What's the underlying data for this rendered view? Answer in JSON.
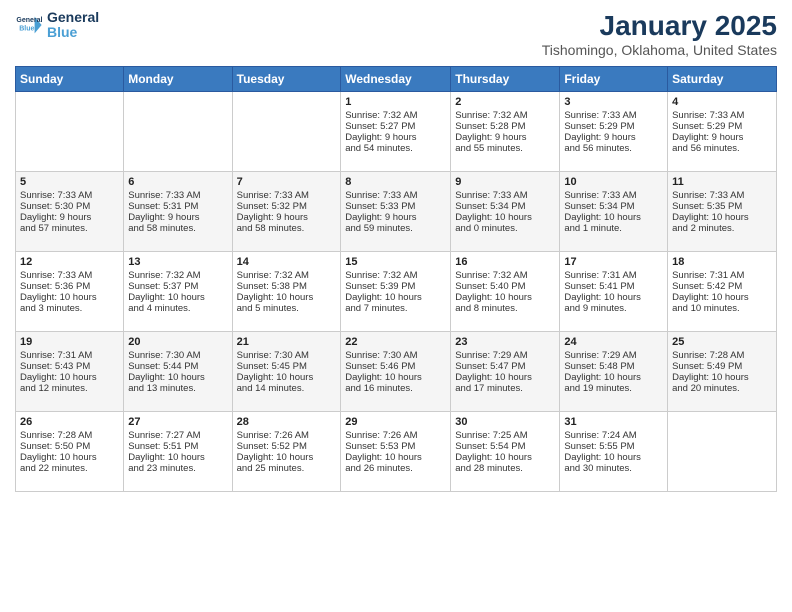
{
  "header": {
    "logo_line1": "General",
    "logo_line2": "Blue",
    "month": "January 2025",
    "location": "Tishomingo, Oklahoma, United States"
  },
  "weekdays": [
    "Sunday",
    "Monday",
    "Tuesday",
    "Wednesday",
    "Thursday",
    "Friday",
    "Saturday"
  ],
  "weeks": [
    [
      {
        "day": "",
        "info": ""
      },
      {
        "day": "",
        "info": ""
      },
      {
        "day": "",
        "info": ""
      },
      {
        "day": "1",
        "info": "Sunrise: 7:32 AM\nSunset: 5:27 PM\nDaylight: 9 hours\nand 54 minutes."
      },
      {
        "day": "2",
        "info": "Sunrise: 7:32 AM\nSunset: 5:28 PM\nDaylight: 9 hours\nand 55 minutes."
      },
      {
        "day": "3",
        "info": "Sunrise: 7:33 AM\nSunset: 5:29 PM\nDaylight: 9 hours\nand 56 minutes."
      },
      {
        "day": "4",
        "info": "Sunrise: 7:33 AM\nSunset: 5:29 PM\nDaylight: 9 hours\nand 56 minutes."
      }
    ],
    [
      {
        "day": "5",
        "info": "Sunrise: 7:33 AM\nSunset: 5:30 PM\nDaylight: 9 hours\nand 57 minutes."
      },
      {
        "day": "6",
        "info": "Sunrise: 7:33 AM\nSunset: 5:31 PM\nDaylight: 9 hours\nand 58 minutes."
      },
      {
        "day": "7",
        "info": "Sunrise: 7:33 AM\nSunset: 5:32 PM\nDaylight: 9 hours\nand 58 minutes."
      },
      {
        "day": "8",
        "info": "Sunrise: 7:33 AM\nSunset: 5:33 PM\nDaylight: 9 hours\nand 59 minutes."
      },
      {
        "day": "9",
        "info": "Sunrise: 7:33 AM\nSunset: 5:34 PM\nDaylight: 10 hours\nand 0 minutes."
      },
      {
        "day": "10",
        "info": "Sunrise: 7:33 AM\nSunset: 5:34 PM\nDaylight: 10 hours\nand 1 minute."
      },
      {
        "day": "11",
        "info": "Sunrise: 7:33 AM\nSunset: 5:35 PM\nDaylight: 10 hours\nand 2 minutes."
      }
    ],
    [
      {
        "day": "12",
        "info": "Sunrise: 7:33 AM\nSunset: 5:36 PM\nDaylight: 10 hours\nand 3 minutes."
      },
      {
        "day": "13",
        "info": "Sunrise: 7:32 AM\nSunset: 5:37 PM\nDaylight: 10 hours\nand 4 minutes."
      },
      {
        "day": "14",
        "info": "Sunrise: 7:32 AM\nSunset: 5:38 PM\nDaylight: 10 hours\nand 5 minutes."
      },
      {
        "day": "15",
        "info": "Sunrise: 7:32 AM\nSunset: 5:39 PM\nDaylight: 10 hours\nand 7 minutes."
      },
      {
        "day": "16",
        "info": "Sunrise: 7:32 AM\nSunset: 5:40 PM\nDaylight: 10 hours\nand 8 minutes."
      },
      {
        "day": "17",
        "info": "Sunrise: 7:31 AM\nSunset: 5:41 PM\nDaylight: 10 hours\nand 9 minutes."
      },
      {
        "day": "18",
        "info": "Sunrise: 7:31 AM\nSunset: 5:42 PM\nDaylight: 10 hours\nand 10 minutes."
      }
    ],
    [
      {
        "day": "19",
        "info": "Sunrise: 7:31 AM\nSunset: 5:43 PM\nDaylight: 10 hours\nand 12 minutes."
      },
      {
        "day": "20",
        "info": "Sunrise: 7:30 AM\nSunset: 5:44 PM\nDaylight: 10 hours\nand 13 minutes."
      },
      {
        "day": "21",
        "info": "Sunrise: 7:30 AM\nSunset: 5:45 PM\nDaylight: 10 hours\nand 14 minutes."
      },
      {
        "day": "22",
        "info": "Sunrise: 7:30 AM\nSunset: 5:46 PM\nDaylight: 10 hours\nand 16 minutes."
      },
      {
        "day": "23",
        "info": "Sunrise: 7:29 AM\nSunset: 5:47 PM\nDaylight: 10 hours\nand 17 minutes."
      },
      {
        "day": "24",
        "info": "Sunrise: 7:29 AM\nSunset: 5:48 PM\nDaylight: 10 hours\nand 19 minutes."
      },
      {
        "day": "25",
        "info": "Sunrise: 7:28 AM\nSunset: 5:49 PM\nDaylight: 10 hours\nand 20 minutes."
      }
    ],
    [
      {
        "day": "26",
        "info": "Sunrise: 7:28 AM\nSunset: 5:50 PM\nDaylight: 10 hours\nand 22 minutes."
      },
      {
        "day": "27",
        "info": "Sunrise: 7:27 AM\nSunset: 5:51 PM\nDaylight: 10 hours\nand 23 minutes."
      },
      {
        "day": "28",
        "info": "Sunrise: 7:26 AM\nSunset: 5:52 PM\nDaylight: 10 hours\nand 25 minutes."
      },
      {
        "day": "29",
        "info": "Sunrise: 7:26 AM\nSunset: 5:53 PM\nDaylight: 10 hours\nand 26 minutes."
      },
      {
        "day": "30",
        "info": "Sunrise: 7:25 AM\nSunset: 5:54 PM\nDaylight: 10 hours\nand 28 minutes."
      },
      {
        "day": "31",
        "info": "Sunrise: 7:24 AM\nSunset: 5:55 PM\nDaylight: 10 hours\nand 30 minutes."
      },
      {
        "day": "",
        "info": ""
      }
    ]
  ]
}
